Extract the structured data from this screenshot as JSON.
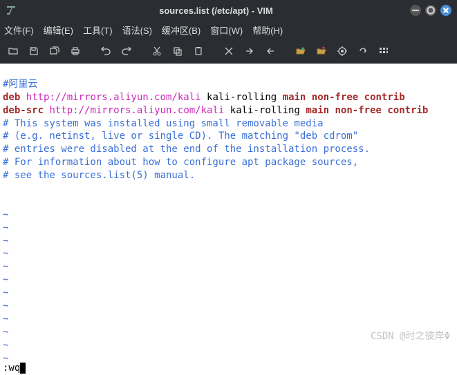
{
  "window": {
    "title": "sources.list (/etc/apt) - VIM"
  },
  "menu": {
    "file": "文件(F)",
    "edit": "编辑(E)",
    "tools": "工具(T)",
    "syntax": "语法(S)",
    "buffers": "缓冲区(B)",
    "window": "窗口(W)",
    "help": "帮助(H)"
  },
  "content": {
    "line1_comment": "#阿里云",
    "line2_key": "deb",
    "line2_url": "http://mirrors.aliyun.com/kali",
    "line2_dist": "kali-rolling",
    "line2_comp": "main non-free contrib",
    "line3_key": "deb-src",
    "line3_url": "http://mirrors.aliyun.com/kali",
    "line3_dist": "kali-rolling",
    "line3_comp": "main non-free contrib",
    "line4": "# This system was installed using small removable media",
    "line5": "# (e.g. netinst, live or single CD). The matching \"deb cdrom\"",
    "line6": "# entries were disabled at the end of the installation process.",
    "line7": "# For information about how to configure apt package sources,",
    "line8": "# see the sources.list(5) manual.",
    "tilde": "~"
  },
  "command": ":wq",
  "watermark": "CSDN @时之彼岸Φ"
}
